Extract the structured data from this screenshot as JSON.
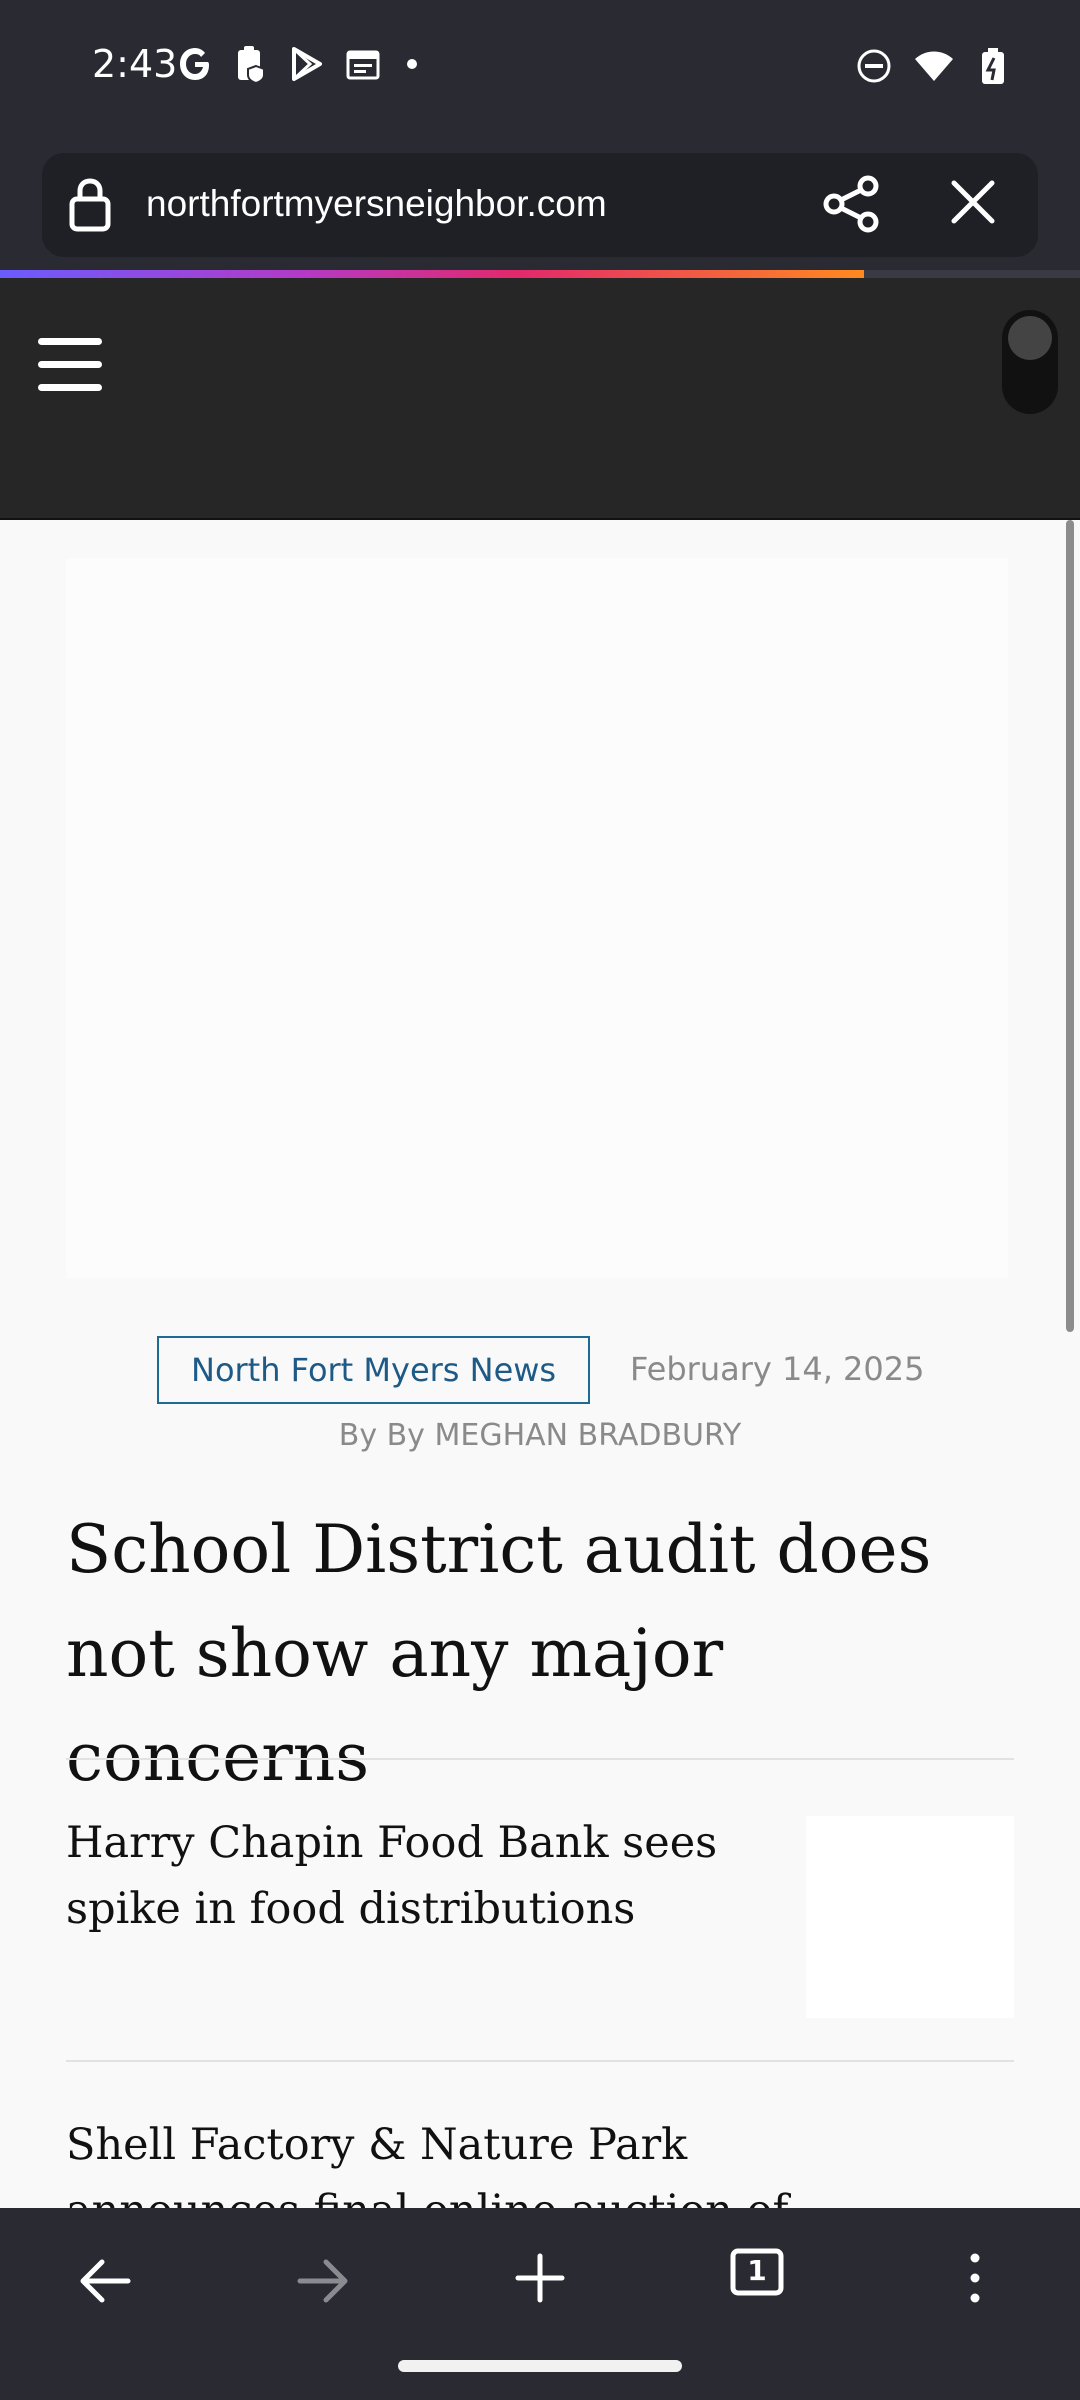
{
  "status_bar": {
    "time": "2:43",
    "left_icons": [
      "google-icon",
      "clipboard-shield-icon",
      "play-store-icon",
      "calendar-icon",
      "dot-icon"
    ],
    "right_icons": [
      "do-not-disturb-icon",
      "wifi-icon",
      "battery-charging-icon"
    ]
  },
  "browser": {
    "url": "northfortmyersneighbor.com",
    "progress_percent": 80,
    "theme_colors": {
      "bar": "#2a2a33",
      "urlbar": "#1f1f26"
    }
  },
  "site": {
    "category": "North Fort Myers News",
    "date": "February 14, 2025",
    "byline": "By By MEGHAN BRADBURY",
    "headline": "School District audit does not show any major concerns",
    "stories": [
      {
        "title": "Harry Chapin Food Bank sees spike in food distributions"
      },
      {
        "title": "Shell Factory & Nature Park announces final online auction of"
      }
    ],
    "accent_color": "#1d6b93"
  },
  "bottom_nav": {
    "tab_count": "1",
    "items": [
      "back-icon",
      "forward-icon",
      "new-tab-icon",
      "tabs-icon",
      "more-icon"
    ]
  }
}
